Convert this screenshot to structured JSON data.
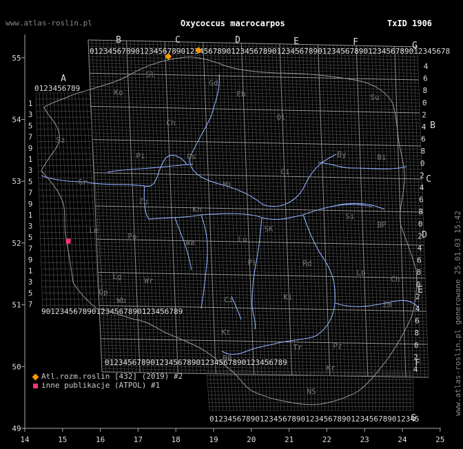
{
  "site": "www.atlas-roslin.pl",
  "title": "Oxycoccus macrocarpos",
  "taxid": "TxID 1906",
  "side_text": "www.atlas-roslin.pl generowane 25.01.03 15:42",
  "legend": [
    {
      "label": "Atl.rozm.roslin [432] (2019) #2",
      "marker": "diamond",
      "color": "#ff9900"
    },
    {
      "label": "inne publikacje (ATPOL) #1",
      "marker": "square",
      "color": "#ff3377"
    }
  ],
  "axes": {
    "x_ticks": [
      "14",
      "15",
      "16",
      "17",
      "18",
      "19",
      "20",
      "21",
      "22",
      "23",
      "24",
      "25"
    ],
    "y_ticks": [
      "49",
      "50",
      "51",
      "52",
      "53",
      "54",
      "55"
    ],
    "lon_range": [
      14,
      25
    ],
    "lat_range": [
      49,
      55.5
    ]
  },
  "grid_letters": [
    "A",
    "B",
    "C",
    "D",
    "E",
    "F",
    "G"
  ],
  "regions": [
    "Sl",
    "Ko",
    "Ch",
    "Sz",
    "Gd",
    "Eb",
    "Ol",
    "Su",
    "Pi",
    "Bi",
    "Mi",
    "Ci",
    "Os",
    "By",
    "Gr",
    "Zg",
    "Le",
    "Po",
    "Kn",
    "SK",
    "Lu",
    "Si",
    "BP",
    "Wa",
    "Pl",
    "Rd",
    "Lb",
    "Ch",
    "Lg",
    "Wr",
    "Wb",
    "Op",
    "Cz",
    "Ki",
    "Zm",
    "Kt",
    "Tr",
    "Pz",
    "Kr",
    "BB",
    "NS"
  ],
  "observations": [
    {
      "lon": 17.8,
      "lat": 55.02,
      "marker": "diamond"
    },
    {
      "lon": 18.6,
      "lat": 55.12,
      "marker": "diamond"
    },
    {
      "lon": 15.15,
      "lat": 52.03,
      "marker": "square"
    }
  ]
}
